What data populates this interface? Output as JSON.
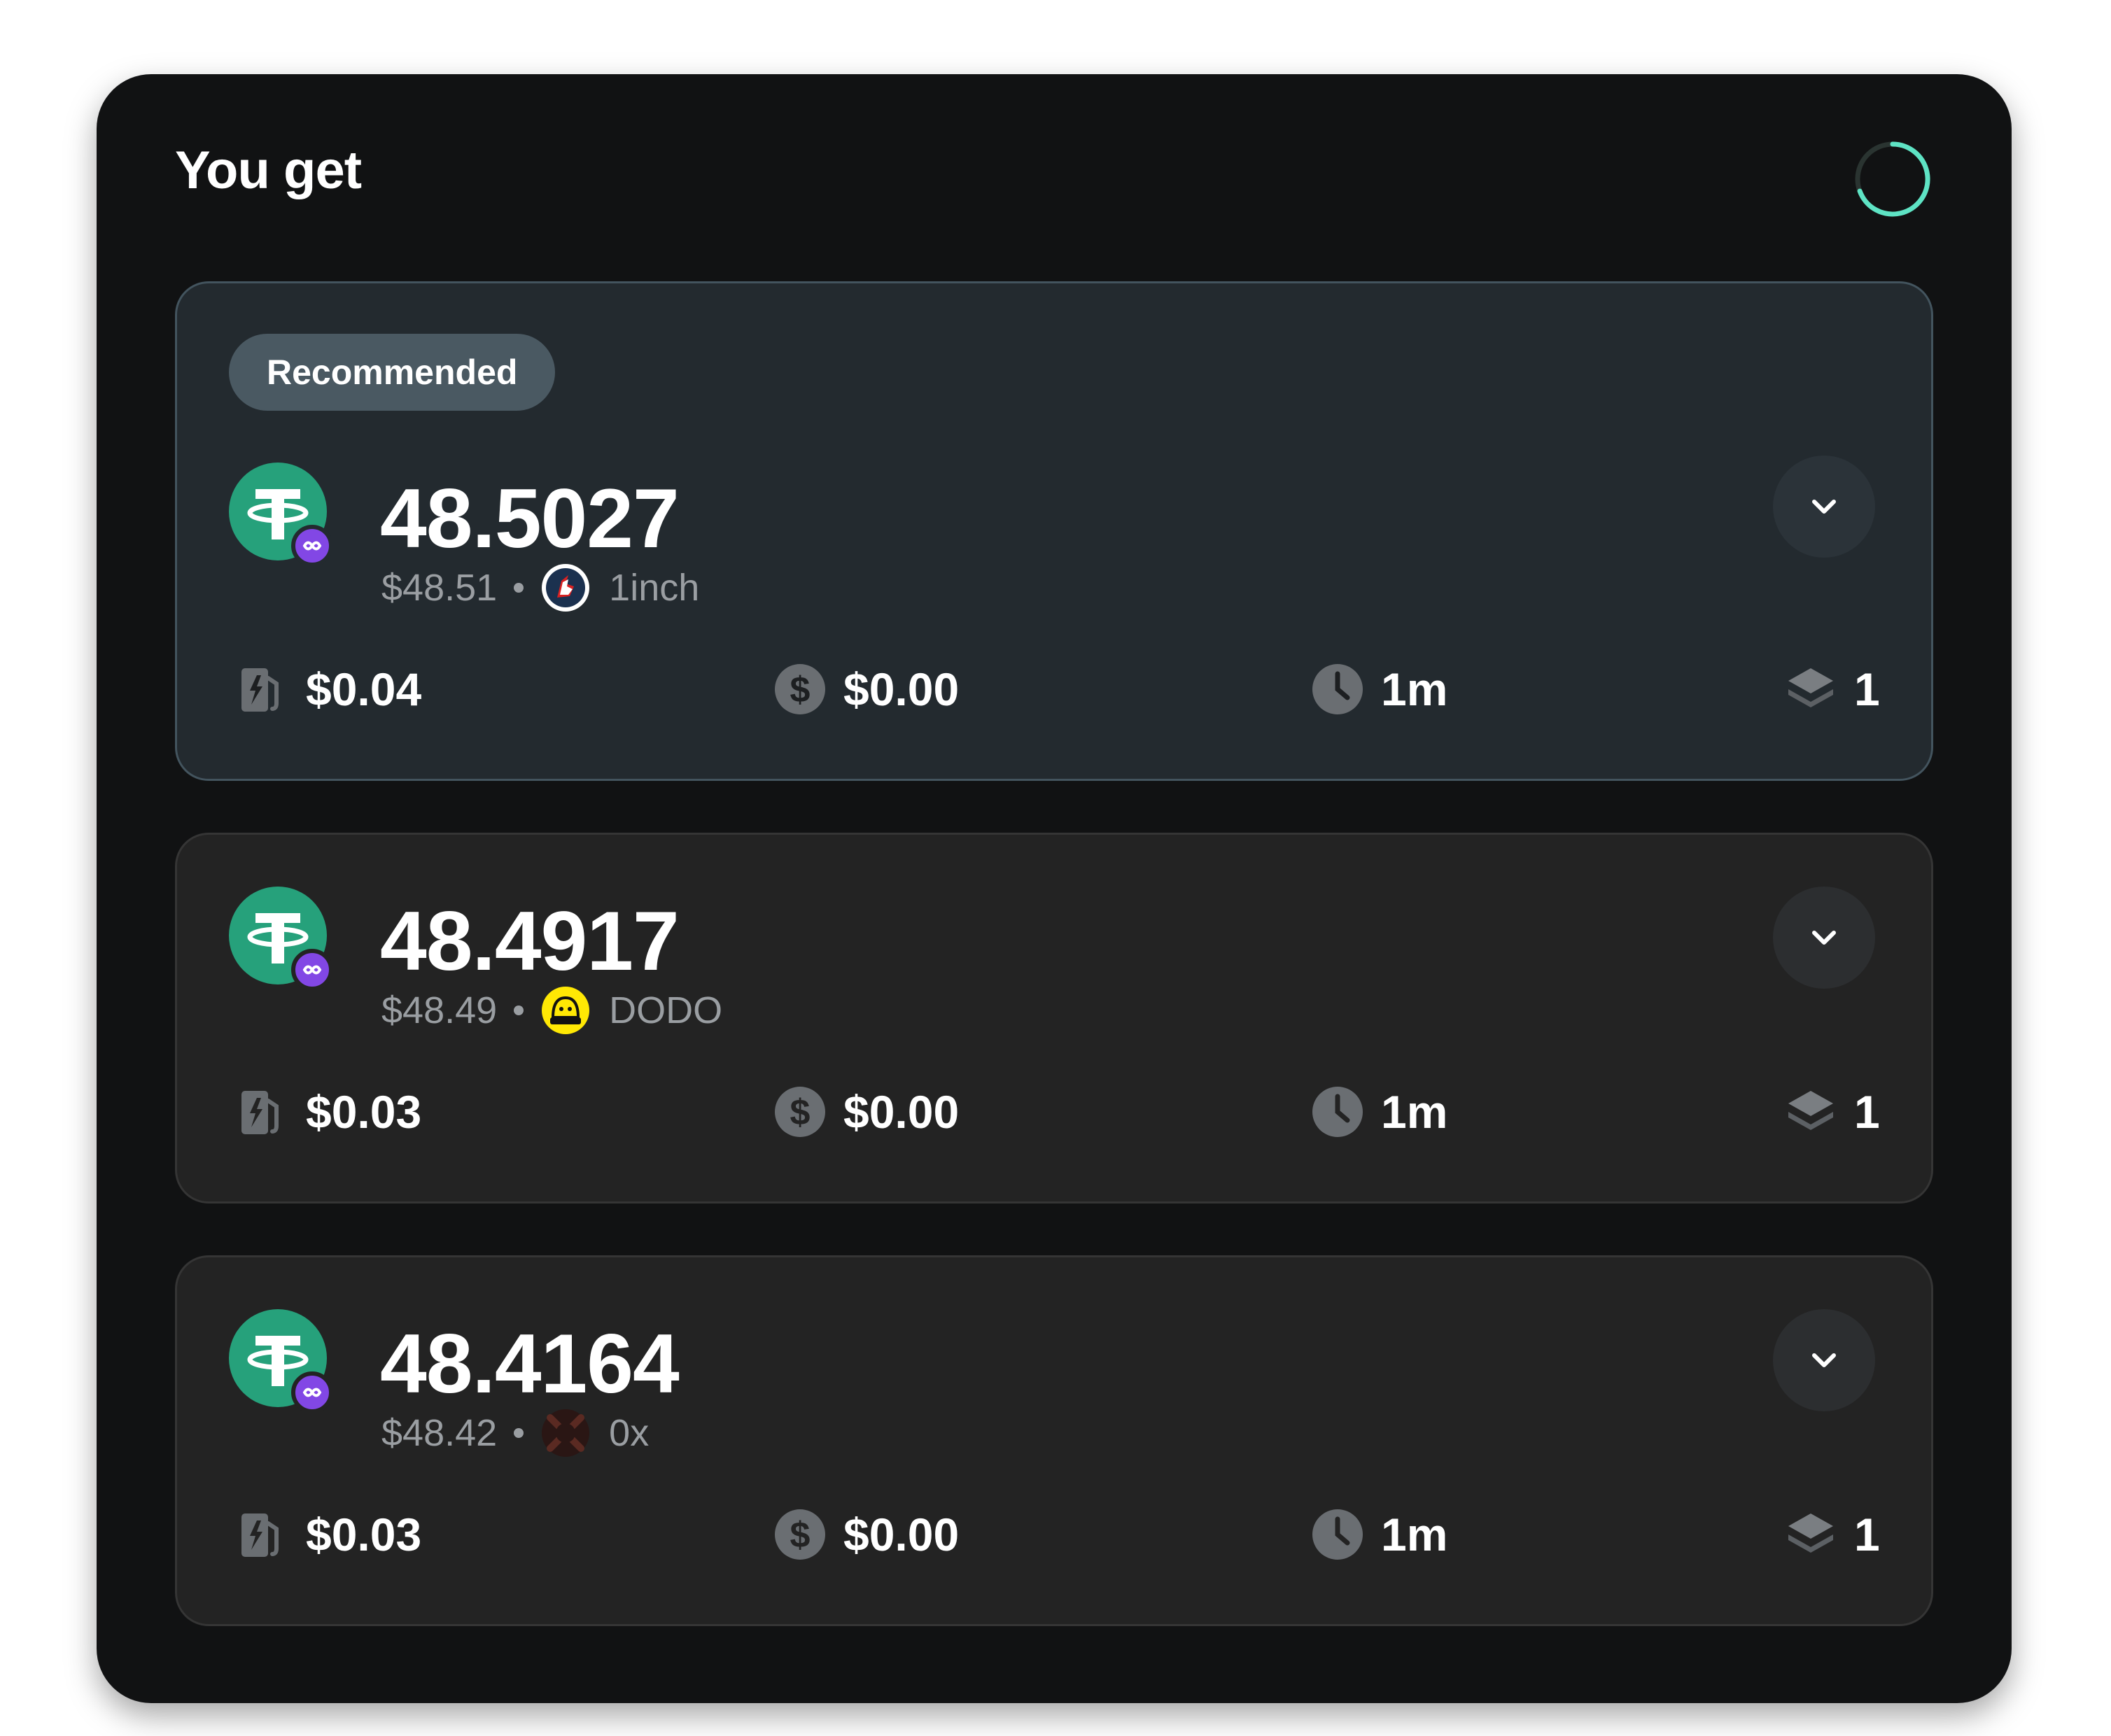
{
  "header": {
    "title": "You get"
  },
  "quotes": [
    {
      "badge": "Recommended",
      "amount": "48.5027",
      "usd_value": "$48.51",
      "provider": {
        "name": "1inch",
        "icon": "1inch-unicorn-icon"
      },
      "stats": {
        "gas": "$0.04",
        "fee": "$0.00",
        "time": "1m",
        "steps": "1"
      }
    },
    {
      "amount": "48.4917",
      "usd_value": "$48.49",
      "provider": {
        "name": "DODO",
        "icon": "dodo-icon"
      },
      "stats": {
        "gas": "$0.03",
        "fee": "$0.00",
        "time": "1m",
        "steps": "1"
      }
    },
    {
      "amount": "48.4164",
      "usd_value": "$48.42",
      "provider": {
        "name": "0x",
        "icon": "0x-icon"
      },
      "stats": {
        "gas": "$0.03",
        "fee": "$0.00",
        "time": "1m",
        "steps": "1"
      }
    }
  ],
  "colors": {
    "panel_bg": "#111213",
    "card_bg": "#232323",
    "recommended_card_bg": "#232a2f",
    "tether_green": "#26a17b",
    "polygon_purple": "#8247e5",
    "spinner_accent": "#5ee3c4",
    "muted_text": "#9a9ea2"
  },
  "icons": {
    "token": "usdt-tether-icon",
    "network": "polygon-icon",
    "gas": "gas-pump-icon",
    "fee": "dollar-coin-icon",
    "time": "clock-icon",
    "steps": "layers-icon",
    "expand": "chevron-down-icon",
    "loading": "loading-spinner-icon"
  }
}
